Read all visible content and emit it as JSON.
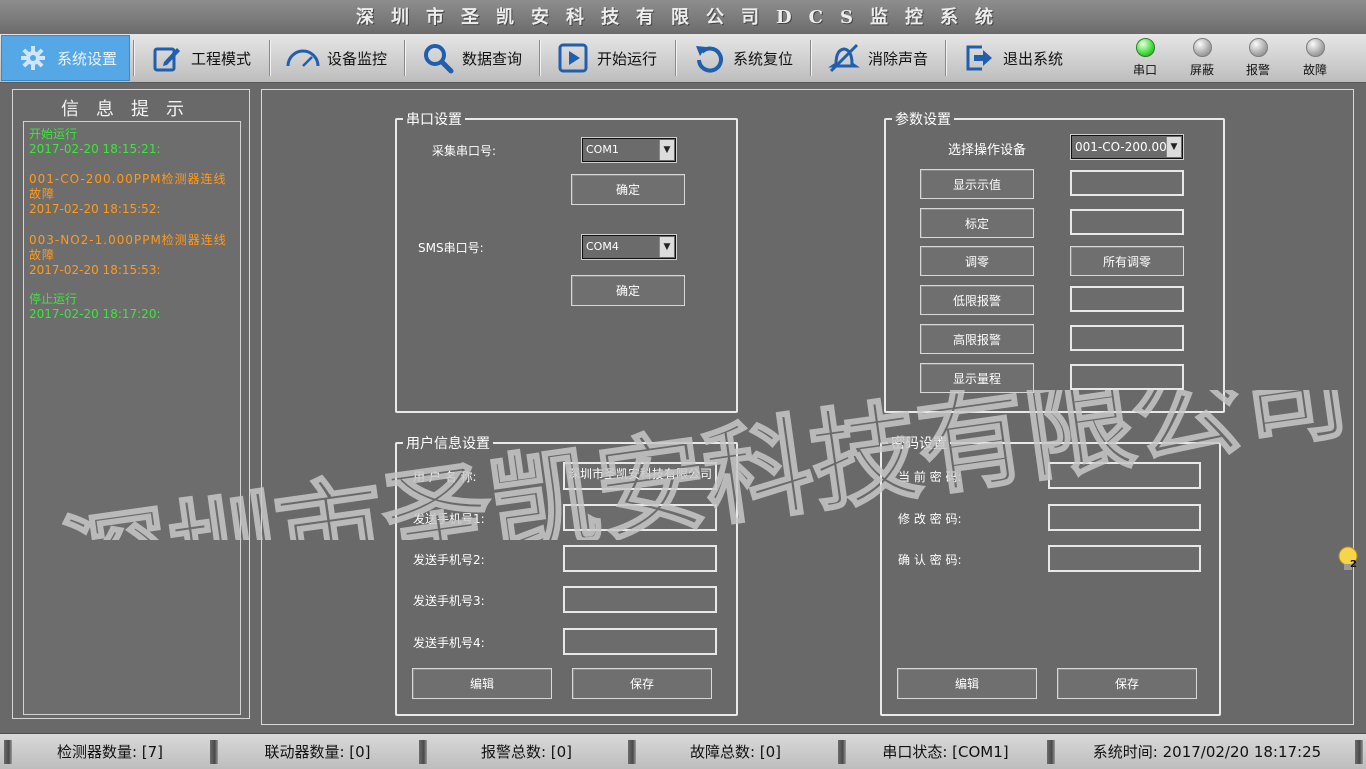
{
  "title": "深圳市圣凯安科技有限公司DCS监控系统",
  "toolbar": {
    "buttons": [
      {
        "label": "系统设置",
        "icon": "gear-icon"
      },
      {
        "label": "工程模式",
        "icon": "edit-icon"
      },
      {
        "label": "设备监控",
        "icon": "gauge-icon"
      },
      {
        "label": "数据查询",
        "icon": "search-icon"
      },
      {
        "label": "开始运行",
        "icon": "play-icon"
      },
      {
        "label": "系统复位",
        "icon": "reset-icon"
      },
      {
        "label": "消除声音",
        "icon": "mute-icon"
      },
      {
        "label": "退出系统",
        "icon": "exit-icon"
      }
    ],
    "indicators": [
      {
        "label": "串口",
        "state": "on"
      },
      {
        "label": "屏蔽",
        "state": "off"
      },
      {
        "label": "报警",
        "state": "off"
      },
      {
        "label": "故障",
        "state": "off"
      }
    ]
  },
  "info": {
    "title": "信息提示",
    "messages": [
      {
        "text": "开始运行",
        "time": "2017-02-20 18:15:21:",
        "color": "#39e839"
      },
      {
        "text": "001-CO-200.00PPM检测器连线故障",
        "time": "2017-02-20 18:15:52:",
        "color": "#ff9a1a"
      },
      {
        "text": "003-NO2-1.000PPM检测器连线故障",
        "time": "2017-02-20 18:15:53:",
        "color": "#ff9a1a"
      },
      {
        "text": "停止运行",
        "time": "2017-02-20 18:17:20:",
        "color": "#39e839"
      }
    ]
  },
  "serial": {
    "legend": "串口设置",
    "collect_label": "采集串口号:",
    "collect_value": "COM1",
    "sms_label": "SMS串口号:",
    "sms_value": "COM4",
    "confirm1": "确定",
    "confirm2": "确定"
  },
  "params": {
    "legend": "参数设置",
    "device_label": "选择操作设备",
    "device_value": "001-CO-200.00",
    "show_value": "显示示值",
    "calibrate": "标定",
    "zero": "调零",
    "zero_all": "所有调零",
    "low_alarm": "低限报警",
    "high_alarm": "高限报警",
    "range": "显示量程"
  },
  "user": {
    "legend": "用户信息设置",
    "name_label": "用 户 名 称:",
    "name_value": "深圳市圣凯安科技有限公司",
    "phone1_label": "发送手机号1:",
    "phone2_label": "发送手机号2:",
    "phone3_label": "发送手机号3:",
    "phone4_label": "发送手机号4:",
    "edit": "编辑",
    "save": "保存"
  },
  "password": {
    "legend": "密码设置",
    "current_label": "当 前 密 码:",
    "change_label": "修 改 密 码:",
    "confirm_label": "确 认 密 码:",
    "edit": "编辑",
    "save": "保存"
  },
  "watermark": "深圳市圣凯安科技有限公司",
  "notification_count": "2",
  "status": {
    "detectors": "检测器数量: [7]",
    "linkers": "联动器数量: [0]",
    "alarms": "报警总数: [0]",
    "faults": "故障总数: [0]",
    "serial": "串口状态: [COM1]",
    "time": "系统时间: 2017/02/20 18:17:25"
  }
}
